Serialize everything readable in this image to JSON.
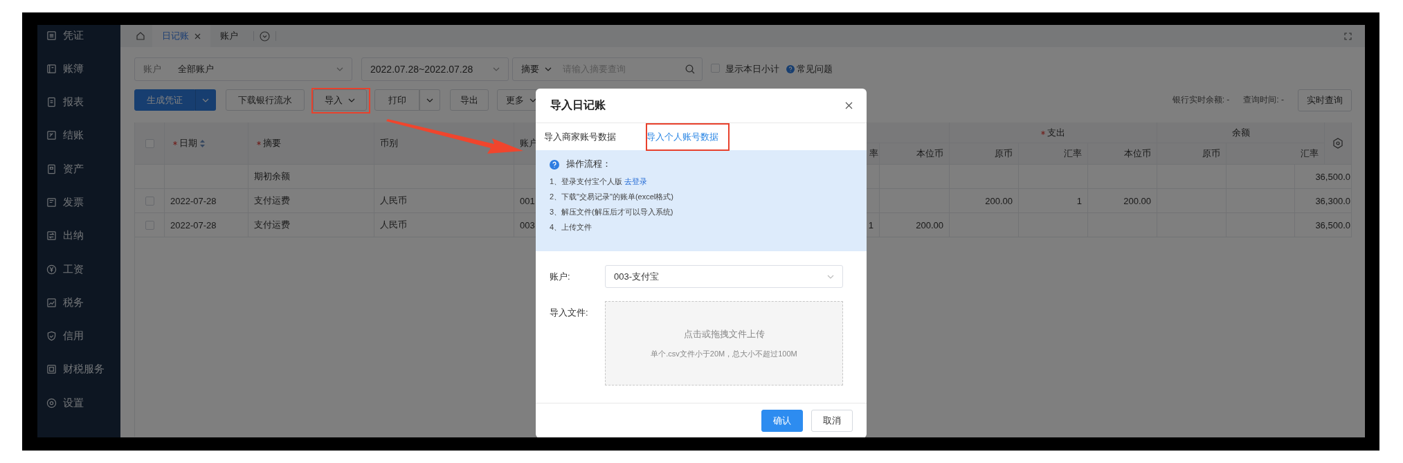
{
  "sidebar": {
    "items": [
      {
        "label": "凭证"
      },
      {
        "label": "账簿"
      },
      {
        "label": "报表"
      },
      {
        "label": "结账"
      },
      {
        "label": "资产"
      },
      {
        "label": "发票"
      },
      {
        "label": "出纳"
      },
      {
        "label": "工资"
      },
      {
        "label": "税务"
      },
      {
        "label": "信用"
      },
      {
        "label": "财税服务"
      },
      {
        "label": "设置"
      }
    ]
  },
  "tabs": [
    {
      "label": "日记账",
      "selected": true,
      "closable": true
    },
    {
      "label": "账户",
      "selected": false,
      "closable": false
    }
  ],
  "filters": {
    "account": {
      "label": "账户",
      "value": "全部账户"
    },
    "date_range": {
      "value": "2022.07.28~2022.07.28"
    },
    "search": {
      "field": "摘要",
      "placeholder": "请输入摘要查询"
    },
    "daily_subtotal": {
      "label": "显示本日小计",
      "checked": false
    },
    "help_link": "常见问题"
  },
  "toolbar": {
    "buttons": [
      {
        "label": "生成凭证",
        "kind": "primary-split"
      },
      {
        "label": "下载银行流水",
        "kind": "plain"
      },
      {
        "label": "导入",
        "kind": "dropdown"
      },
      {
        "label": "打印",
        "kind": "split"
      },
      {
        "label": "导出",
        "kind": "plain"
      },
      {
        "label": "更多",
        "kind": "dropdown"
      }
    ],
    "bank_balance": {
      "label": "银行实时余额:",
      "value": "-"
    },
    "query_time": {
      "label": "查询时间:",
      "value": "-"
    },
    "query_button": "实时查询"
  },
  "table": {
    "select_all": {
      "checked": false
    },
    "columns": [
      {
        "label": "日期",
        "required": true,
        "sortable": true
      },
      {
        "label": "摘要",
        "required": true,
        "sortable": false
      },
      {
        "label": "币别",
        "required": false,
        "sortable": false
      },
      {
        "label": "账户",
        "required": false
      }
    ],
    "income_columns": [
      "率",
      "本位币"
    ],
    "groups": [
      {
        "label": "支出",
        "required": true,
        "columns": [
          "原币",
          "汇率",
          "本位币"
        ]
      },
      {
        "label": "余额",
        "required": false,
        "columns": [
          "原币",
          "汇率"
        ]
      }
    ],
    "rows": [
      {
        "kind": "opening",
        "summary": "期初余额",
        "balance": "36,500.0"
      },
      {
        "kind": "entry",
        "checked": false,
        "date": "2022-07-28",
        "summary": "支付运费",
        "currency": "人民币",
        "account": "001",
        "expense": [
          "200.00",
          "1",
          "200.00"
        ],
        "balance": "36,300.0"
      },
      {
        "kind": "entry",
        "checked": false,
        "date": "2022-07-28",
        "summary": "支付运费",
        "currency": "人民币",
        "account": "003",
        "income": [
          "1",
          "200.00"
        ],
        "balance": "36,500.0"
      }
    ]
  },
  "dialog": {
    "title": "导入日记账",
    "tabs": [
      {
        "label": "导入商家账号数据",
        "selected": false
      },
      {
        "label": "导入个人账号数据",
        "selected": true
      }
    ],
    "notice": {
      "title": "操作流程：",
      "steps": [
        {
          "text": "1、登录支付宝个人版",
          "link": "去登录"
        },
        {
          "text": "2、下载\"交易记录\"的账单(excel格式)"
        },
        {
          "text": "3、解压文件(解压后才可以导入系统)"
        },
        {
          "text": "4、上传文件"
        }
      ]
    },
    "account": {
      "label": "账户:",
      "value": "003-支付宝"
    },
    "upload": {
      "label": "导入文件:",
      "hint": "点击或拖拽文件上传",
      "note": "单个.csv文件小于20M，总大小不超过100M"
    },
    "buttons": [
      {
        "label": "确认",
        "kind": "primary"
      },
      {
        "label": "取消",
        "kind": "default"
      }
    ]
  }
}
